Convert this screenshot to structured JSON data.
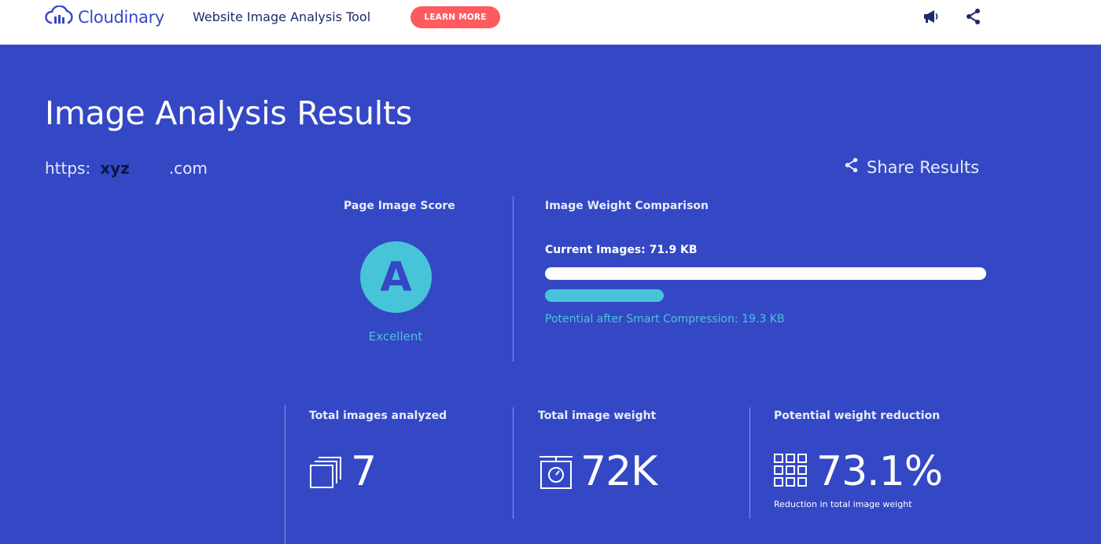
{
  "header": {
    "logo_text": "Cloudinary",
    "tool_title": "Website Image Analysis Tool",
    "learn_more_label": "LEARN MORE",
    "icons": [
      "megaphone-icon",
      "share-icon"
    ]
  },
  "main": {
    "title": "Image Analysis Results",
    "url_prefix": "https:",
    "url_mid": "xyz",
    "url_suffix": ".com",
    "share_results_label": "Share Results"
  },
  "score": {
    "label": "Page Image Score",
    "grade": "A",
    "description": "Excellent"
  },
  "weight_comparison": {
    "label": "Image Weight Comparison",
    "current_label": "Current Images: 71.9 KB",
    "current_kb": 71.9,
    "potential_label": "Potential after Smart Compression: 19.3 KB",
    "potential_kb": 19.3
  },
  "stats": [
    {
      "label": "Total images analyzed",
      "value": "7",
      "icon": "images-stack-icon"
    },
    {
      "label": "Total image weight",
      "value": "72K",
      "icon": "scale-icon"
    },
    {
      "label": "Potential weight reduction",
      "value": "73.1%",
      "icon": "grid-icon",
      "sub": "Reduction in total image weight"
    }
  ],
  "colors": {
    "background": "#3448c5",
    "accent_cyan": "#48c4d8",
    "learn_more": "#ff5a5f",
    "header_bg": "#ffffff"
  }
}
